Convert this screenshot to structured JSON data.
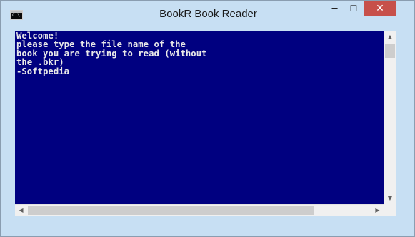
{
  "window": {
    "title": "BookR Book Reader",
    "icon": "cmd-console-icon",
    "icon_text": "C:\\",
    "controls": {
      "minimize": "─",
      "maximize": "☐",
      "close": "✕"
    }
  },
  "console": {
    "text": "Welcome!\nplease type the file name of the\nbook you are trying to read (without\nthe .bkr)\n-Softpedia",
    "background_color": "#000080",
    "text_color": "#e8e8e8"
  },
  "scrollbars": {
    "vertical": {
      "up_arrow": "▲",
      "down_arrow": "▼"
    },
    "horizontal": {
      "left_arrow": "◀",
      "right_arrow": "▶"
    }
  }
}
